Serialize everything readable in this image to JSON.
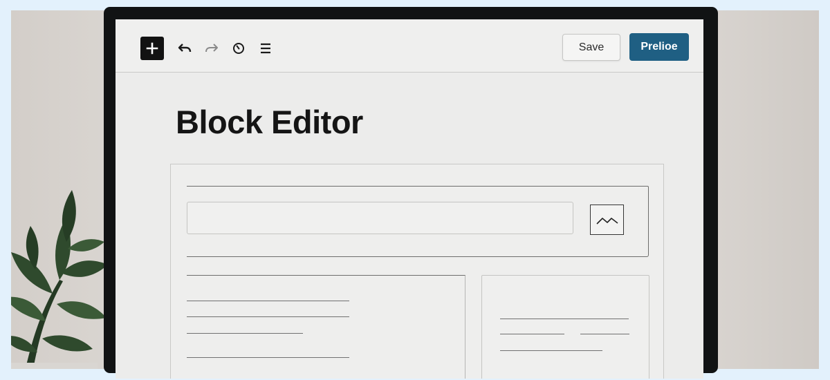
{
  "toolbar": {
    "add_icon": "plus-icon",
    "undo_icon": "undo-icon",
    "redo_icon": "redo-icon",
    "details_icon": "info-circle-icon",
    "outline_icon": "list-view-icon",
    "save_label": "Save",
    "preview_label": "Prelioe",
    "accent_color": "#1f5f83"
  },
  "editor": {
    "title": "Block Editor",
    "image_icon": "image-icon"
  }
}
